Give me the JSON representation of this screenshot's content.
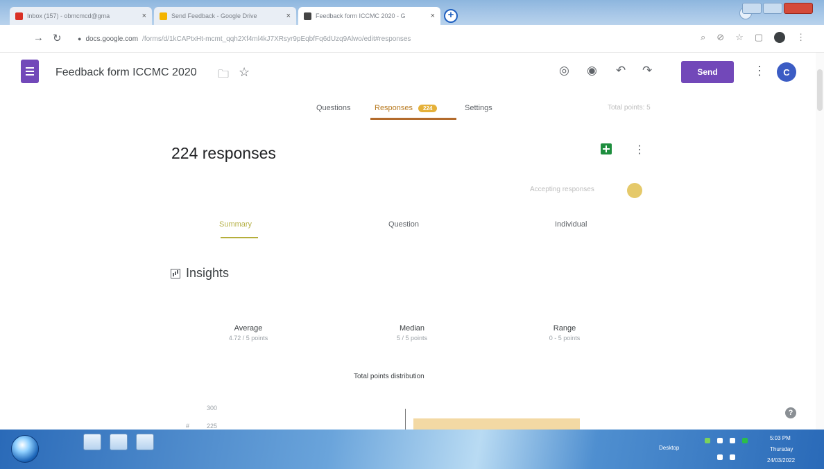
{
  "browser": {
    "tabs": [
      {
        "title": "Inbox (157) - obmcmcd@gma",
        "favicon_color": "#d93025",
        "active": false
      },
      {
        "title": "Send Feedback - Google Drive",
        "favicon_color": "#f4b400",
        "active": false
      },
      {
        "title": "Feedback form ICCMC 2020 - G",
        "favicon_color": "#444444",
        "active": true
      }
    ],
    "address": {
      "host": "docs.google.com",
      "path": "/forms/d/1kCAPtxHt-mcmt_qqh2Xf4ml4kJ7XRsyr9pEqbfFq6dUzq9Alwo/edit#responses"
    }
  },
  "header": {
    "form_title": "Feedback form ICCMC 2020",
    "send_label": "Send",
    "avatar_initial": "C"
  },
  "form_tabs": {
    "questions": "Questions",
    "responses": "Responses",
    "responses_badge": "224",
    "settings": "Settings",
    "total_score": "Total points: 5"
  },
  "responses": {
    "count_text": "224 responses",
    "accepting_text": "Accepting responses",
    "subtabs": [
      "Summary",
      "Question",
      "Individual"
    ]
  },
  "insights": {
    "title": "Insights",
    "stats": [
      {
        "label": "Average",
        "value": "4.72 / 5 points"
      },
      {
        "label": "Median",
        "value": "5 / 5 points"
      },
      {
        "label": "Range",
        "value": "0 - 5 points"
      }
    ]
  },
  "chart_data": {
    "type": "bar",
    "title": "Total points distribution",
    "ylabel": "#",
    "y_ticks": [
      "300",
      "225"
    ]
  },
  "help_glyph": "?",
  "taskbar": {
    "desktop_label": "Desktop",
    "time": "5:03 PM",
    "day": "Thursday",
    "date": "24/03/2022"
  },
  "colors": {
    "forms_purple": "#7248b9",
    "responses_accent": "#b36b2c",
    "chart_bar": "#f3d9a4"
  }
}
